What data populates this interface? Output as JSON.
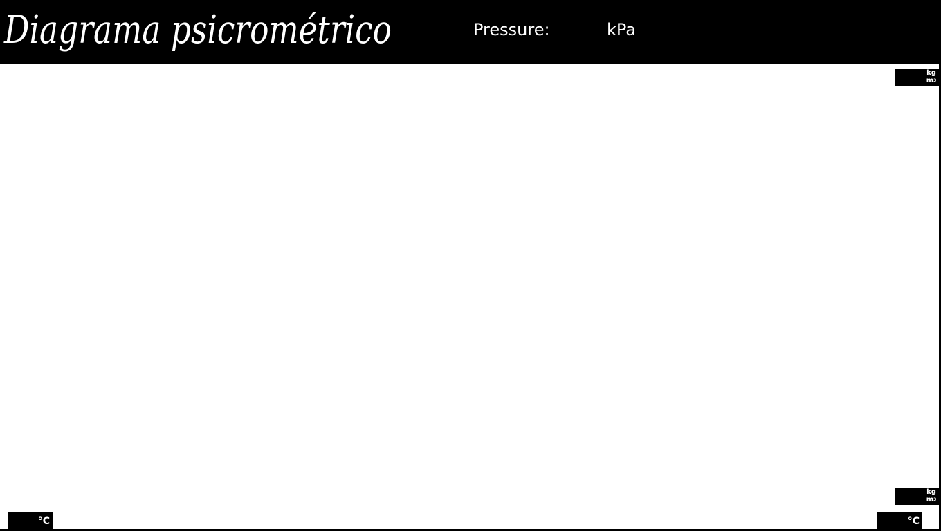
{
  "header": {
    "title": "Diagrama psicrométrico",
    "pressure_label": "Pressure:",
    "pressure_value": "",
    "pressure_unit": "kPa"
  },
  "chart": {
    "density_top": {
      "value": "",
      "unit_num": "kg",
      "unit_den": "m",
      "unit_exp": "3"
    },
    "density_bottom": {
      "value": "",
      "unit_num": "kg",
      "unit_den": "m",
      "unit_exp": "3"
    },
    "temp_left": {
      "value": "",
      "unit": "°C"
    },
    "temp_right": {
      "value": "",
      "unit": "°C"
    }
  },
  "colors": {
    "background": "#000000",
    "chart_background": "#ffffff",
    "text": "#ffffff"
  }
}
